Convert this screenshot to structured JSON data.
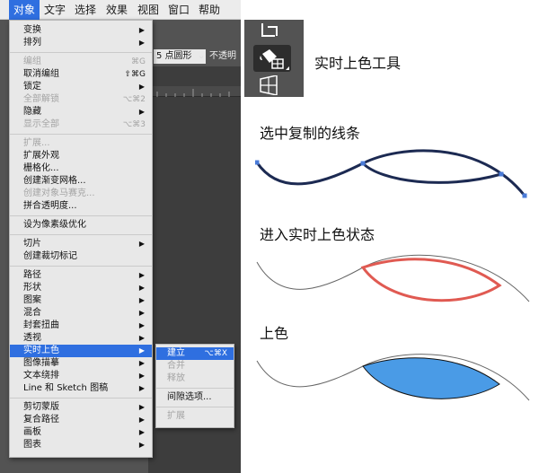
{
  "menubar": {
    "items": [
      "对象",
      "文字",
      "选择",
      "效果",
      "视图",
      "窗口",
      "帮助"
    ],
    "active": "对象"
  },
  "control_bar": {
    "brush_value": "5 点圆形",
    "opacity_label": "不透明"
  },
  "menu": {
    "items": [
      {
        "label": "变换",
        "arrow": true
      },
      {
        "label": "排列",
        "arrow": true
      },
      {
        "sep": true
      },
      {
        "label": "编组",
        "shortcut": "⌘G",
        "disabled": true
      },
      {
        "label": "取消编组",
        "shortcut": "⇧⌘G"
      },
      {
        "label": "锁定",
        "arrow": true
      },
      {
        "label": "全部解锁",
        "shortcut": "⌥⌘2",
        "disabled": true
      },
      {
        "label": "隐藏",
        "arrow": true
      },
      {
        "label": "显示全部",
        "shortcut": "⌥⌘3",
        "disabled": true
      },
      {
        "sep": true
      },
      {
        "label": "扩展...",
        "disabled": true
      },
      {
        "label": "扩展外观"
      },
      {
        "label": "栅格化..."
      },
      {
        "label": "创建渐变网格..."
      },
      {
        "label": "创建对象马赛克...",
        "disabled": true
      },
      {
        "label": "拼合透明度..."
      },
      {
        "sep": true
      },
      {
        "label": "设为像素级优化"
      },
      {
        "sep": true
      },
      {
        "label": "切片",
        "arrow": true
      },
      {
        "label": "创建裁切标记"
      },
      {
        "sep": true
      },
      {
        "label": "路径",
        "arrow": true
      },
      {
        "label": "形状",
        "arrow": true
      },
      {
        "label": "图案",
        "arrow": true
      },
      {
        "label": "混合",
        "arrow": true
      },
      {
        "label": "封套扭曲",
        "arrow": true
      },
      {
        "label": "透视",
        "arrow": true
      },
      {
        "label": "实时上色",
        "arrow": true,
        "highlighted": true
      },
      {
        "label": "图像描摹",
        "arrow": true
      },
      {
        "label": "文本绕排",
        "arrow": true
      },
      {
        "label": "Line 和 Sketch 图稿",
        "arrow": true
      },
      {
        "sep": true
      },
      {
        "label": "剪切蒙版",
        "arrow": true
      },
      {
        "label": "复合路径",
        "arrow": true
      },
      {
        "label": "画板",
        "arrow": true
      },
      {
        "label": "图表",
        "arrow": true
      }
    ]
  },
  "submenu": {
    "items": [
      {
        "label": "建立",
        "shortcut": "⌥⌘X",
        "highlighted": true
      },
      {
        "label": "合并",
        "disabled": true
      },
      {
        "label": "释放",
        "disabled": true
      },
      {
        "sep": true
      },
      {
        "label": "间隙选项..."
      },
      {
        "sep": true
      },
      {
        "label": "扩展",
        "disabled": true
      }
    ]
  },
  "toolbox": {
    "tool_icons": [
      "shape-builder-icon",
      "live-paint-bucket-icon",
      "perspective-grid-icon"
    ]
  },
  "annotations": {
    "tool_caption": "实时上色工具",
    "step1": "选中复制的线条",
    "step2": "进入实时上色状态",
    "step3": "上色"
  },
  "colors": {
    "menu_highlight": "#2f6fe0",
    "selected_path": "#1c2a52",
    "anchor_points": "#4a7bd8",
    "live_paint_outline": "#e05a52",
    "fill": "#4a9be6"
  }
}
